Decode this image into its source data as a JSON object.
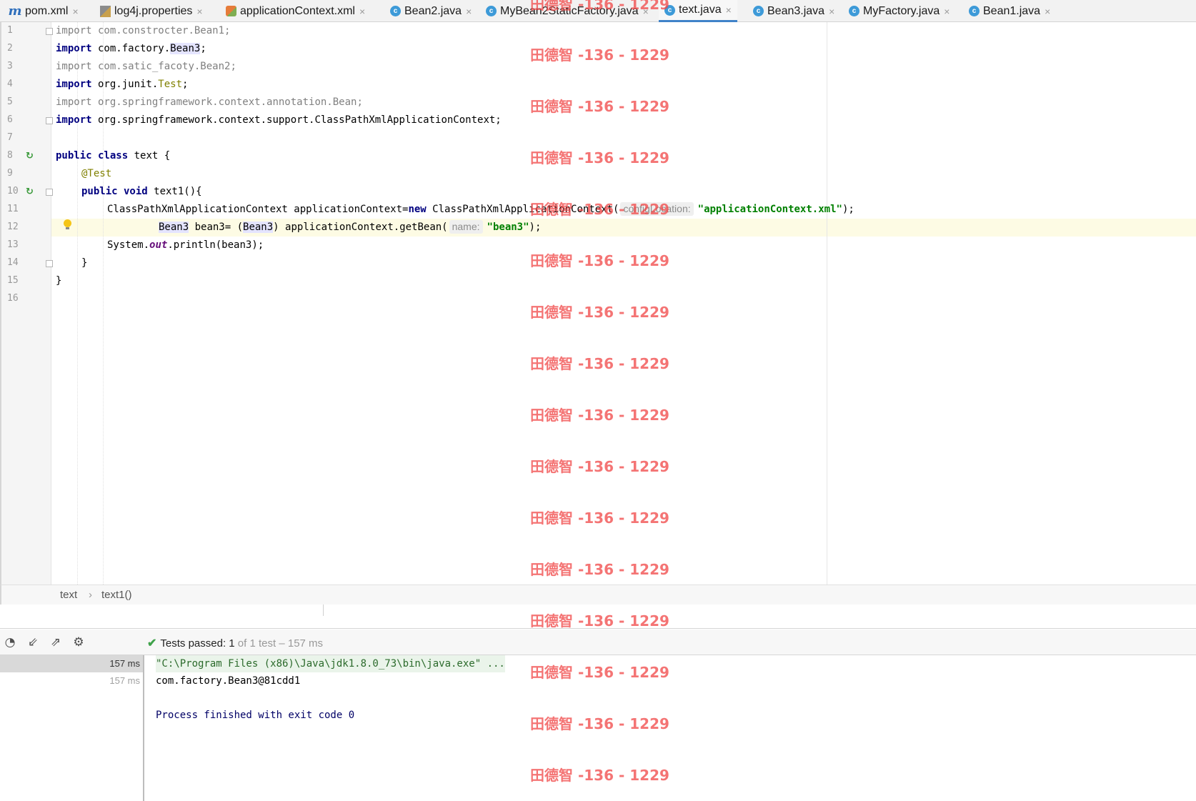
{
  "tabs": [
    {
      "label": "pom.xml",
      "icon": "maven-icon",
      "close": "×"
    },
    {
      "label": "log4j.properties",
      "icon": "properties-file-icon",
      "close": "×"
    },
    {
      "label": "applicationContext.xml",
      "icon": "spring-xml-icon",
      "close": "×"
    },
    {
      "label": "Bean2.java",
      "icon": "java-class-icon",
      "close": "×"
    },
    {
      "label": "MyBean2StaticFactory.java",
      "icon": "java-class-icon",
      "close": "×"
    },
    {
      "label": "text.java",
      "icon": "java-class-icon",
      "close": "×",
      "active": true
    },
    {
      "label": "Bean3.java",
      "icon": "java-class-icon",
      "close": "×"
    },
    {
      "label": "MyFactory.java",
      "icon": "java-class-icon",
      "close": "×"
    },
    {
      "label": "Bean1.java",
      "icon": "java-class-icon",
      "close": "×"
    }
  ],
  "editor": {
    "line_numbers": [
      "1",
      "2",
      "3",
      "4",
      "5",
      "6",
      "7",
      "8",
      "9",
      "10",
      "11",
      "12",
      "13",
      "14",
      "15",
      "16"
    ],
    "code": {
      "l1_kw": "import",
      "l1_rest": " com.constrocter.Bean1;",
      "l2_kw": "import",
      "l2_a": " com.factory.",
      "l2_b": "Bean3",
      "l2_c": ";",
      "l3_kw": "import",
      "l3_rest": " com.satic_facoty.Bean2;",
      "l4_kw": "import",
      "l4_a": " org.junit.",
      "l4_b": "Test",
      "l4_c": ";",
      "l5_kw": "import",
      "l5_rest": " org.springframework.context.annotation.Bean;",
      "l6_kw": "import",
      "l6_rest": " org.springframework.context.support.ClassPathXmlApplicationContext;",
      "l8_kw": "public class",
      "l8_rest": " text {",
      "l9_ann": "@Test",
      "l10_kw": "public void",
      "l10_rest": " text1(){",
      "l11_a": "ClassPathXmlApplicationContext applicationContext=",
      "l11_kw": "new",
      "l11_b": " ClassPathXmlApplicationContext(",
      "l11_hint": "configLocation:",
      "l11_str": "\"applicationContext.xml\"",
      "l11_c": ");",
      "l12_a": "Bean3",
      "l12_b": " bean3= (",
      "l12_c": "Bean3",
      "l12_d": ") applicationContext.getBean(",
      "l12_hint": "name:",
      "l12_str": "\"bean3\"",
      "l12_e": ");",
      "l13_a": "System.",
      "l13_it": "out",
      "l13_b": ".println(bean3);",
      "l14": "}",
      "l15": "}"
    }
  },
  "breadcrumb": {
    "class": "text",
    "sep": "›",
    "method": "text1()"
  },
  "run_panel": {
    "status": {
      "check": "✔",
      "prefix": "Tests passed: ",
      "count": "1",
      "suffix": " of 1 test – 157 ms"
    },
    "tree": [
      {
        "time": "157 ms",
        "selected": true
      },
      {
        "time": "157 ms",
        "selected": false
      }
    ],
    "console": {
      "line1": "\"C:\\Program Files (x86)\\Java\\jdk1.8.0_73\\bin\\java.exe\" ...",
      "line2": "com.factory.Bean3@81cdd1",
      "line3": "Process finished with exit code 0"
    }
  },
  "watermark": "田德智 -136 - 1229",
  "colors": {
    "accent": "#4083c9",
    "keyword": "#000080",
    "string": "#008000",
    "annotation": "#808000",
    "watermark": "#f04646",
    "pass": "#3fa24a"
  }
}
